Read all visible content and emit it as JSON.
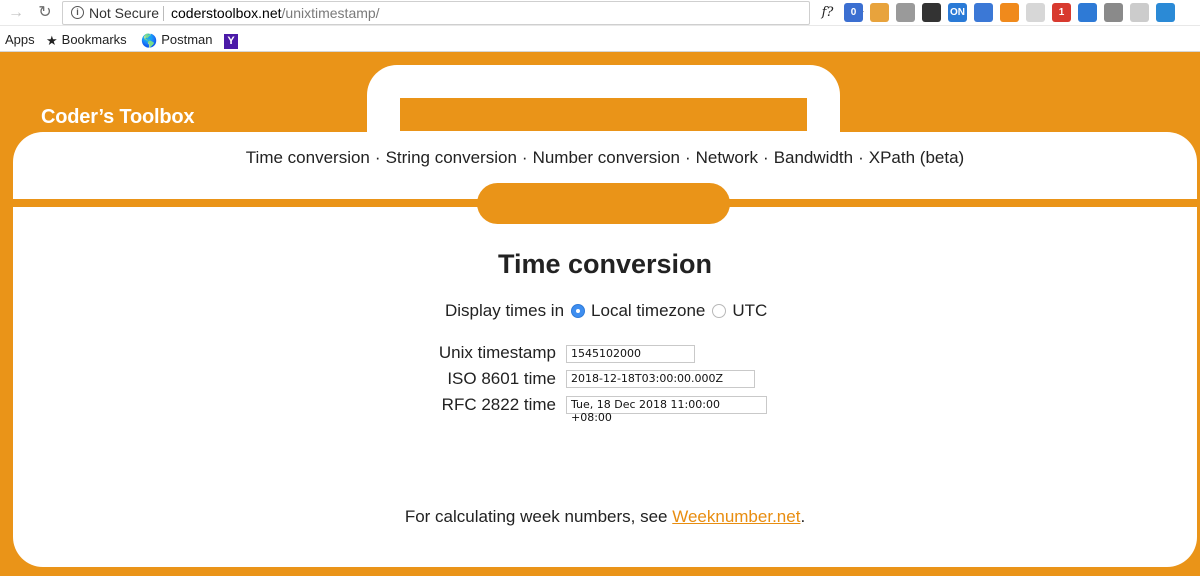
{
  "browser": {
    "security_label": "Not Secure",
    "url_host": "coderstoolbox.net",
    "url_path": "/unixtimestamp/",
    "extensions": [
      {
        "name": "formula-f-icon",
        "text": "f?",
        "color": "#ffffff"
      },
      {
        "name": "ext-counter-icon",
        "text": "0",
        "color": "#3b6fd1"
      },
      {
        "name": "ext-orange-flag-icon",
        "text": "",
        "color": "#e8a33c"
      },
      {
        "name": "ext-globe-icon",
        "text": "",
        "color": "#9a9a9a"
      },
      {
        "name": "ext-sync-icon",
        "text": "",
        "color": "#333333"
      },
      {
        "name": "ext-on-icon",
        "text": "ON",
        "color": "#2a7ad6"
      },
      {
        "name": "ext-blue-square-icon",
        "text": "",
        "color": "#3b78d6"
      },
      {
        "name": "ext-chart-icon",
        "text": "",
        "color": "#f08a1c"
      },
      {
        "name": "ext-grid-icon",
        "text": "",
        "color": "#d7d7d7"
      },
      {
        "name": "ext-red-badge-icon",
        "text": "1",
        "color": "#d83a2f"
      },
      {
        "name": "ext-multicolor-icon",
        "text": "",
        "color": "#2e7ad6"
      },
      {
        "name": "ext-v-icon",
        "text": "",
        "color": "#8a8a8a"
      },
      {
        "name": "ext-grey-circle-icon",
        "text": "",
        "color": "#cccccc"
      },
      {
        "name": "ext-blue-bracket-icon",
        "text": "",
        "color": "#2b8ad6"
      }
    ]
  },
  "bookmarks": {
    "apps": "Apps",
    "bookmarks": "Bookmarks",
    "postman": "Postman",
    "yahoo": "Y"
  },
  "site": {
    "logo": "Coder’s Toolbox",
    "nav": [
      "Time conversion",
      "String conversion",
      "Number conversion",
      "Network",
      "Bandwidth",
      "XPath (beta)"
    ],
    "nav_separator": "·"
  },
  "main": {
    "title": "Time conversion",
    "display_label": "Display times in",
    "local_option": "Local timezone",
    "utc_option": "UTC",
    "selected_option": "Local timezone",
    "unix_label": "Unix timestamp",
    "unix_value": "1545102000",
    "iso_label": "ISO 8601 time",
    "iso_value": "2018-12-18T03:00:00.000Z",
    "rfc_label": "RFC 2822 time",
    "rfc_value": "Tue, 18 Dec 2018 11:00:00 +08:00",
    "footer_text": "For calculating week numbers, see ",
    "footer_link": "Weeknumber.net",
    "footer_end": "."
  },
  "colors": {
    "brand_orange": "#ea9418",
    "link": "#e88d10",
    "radio_selected": "#3e8ef0"
  }
}
